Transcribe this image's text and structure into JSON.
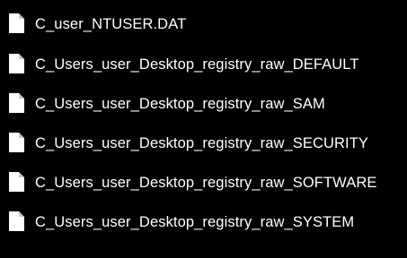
{
  "files": [
    {
      "name": "C_user_NTUSER.DAT",
      "icon": "file-icon"
    },
    {
      "name": "C_Users_user_Desktop_registry_raw_DEFAULT",
      "icon": "file-icon"
    },
    {
      "name": "C_Users_user_Desktop_registry_raw_SAM",
      "icon": "file-icon"
    },
    {
      "name": "C_Users_user_Desktop_registry_raw_SECURITY",
      "icon": "file-icon"
    },
    {
      "name": "C_Users_user_Desktop_registry_raw_SOFTWARE",
      "icon": "file-icon"
    },
    {
      "name": "C_Users_user_Desktop_registry_raw_SYSTEM",
      "icon": "file-icon"
    }
  ],
  "colors": {
    "background": "#000000",
    "text": "#ffffff",
    "icon_fill": "#ffffff",
    "icon_fold": "#c8c8c8"
  }
}
